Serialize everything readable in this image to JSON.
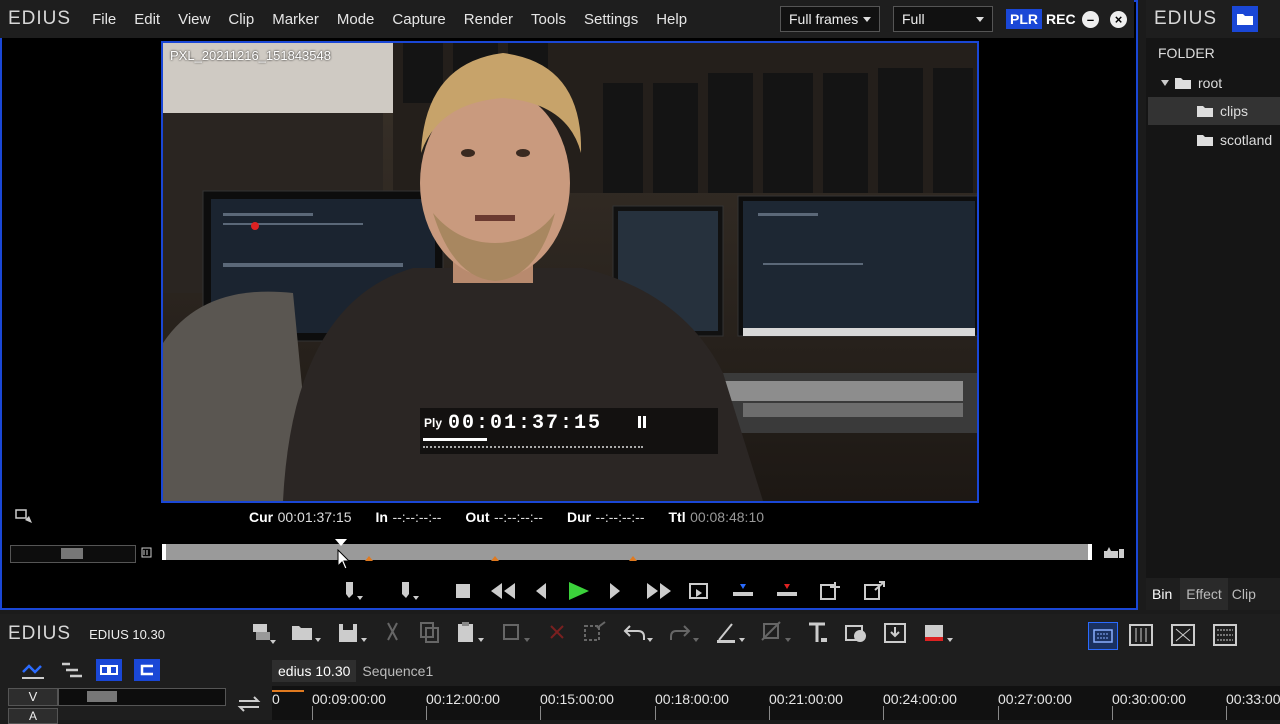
{
  "app": {
    "logo": "EDIUS"
  },
  "menu": [
    "File",
    "Edit",
    "View",
    "Clip",
    "Marker",
    "Mode",
    "Capture",
    "Render",
    "Tools",
    "Settings",
    "Help"
  ],
  "player": {
    "frames_mode": "Full frames",
    "quality": "Full",
    "plr": "PLR",
    "rec": "REC",
    "clip_name": "PXL_20211216_151843548",
    "osd_mode": "Ply",
    "osd_timecode": "00:01:37:15",
    "cur_label": "Cur",
    "cur_value": "00:01:37:15",
    "in_label": "In",
    "in_value": "--:--:--:--",
    "out_label": "Out",
    "out_value": "--:--:--:--",
    "dur_label": "Dur",
    "dur_value": "--:--:--:--",
    "ttl_label": "Ttl",
    "ttl_value": "00:08:48:10",
    "playhead_fraction": 0.19
  },
  "bin": {
    "logo": "EDIUS",
    "folder_header": "FOLDER",
    "root": "root",
    "folders": [
      "clips",
      "scotland"
    ],
    "tabs": [
      "Bin",
      "Effect",
      "Clip"
    ]
  },
  "timeline": {
    "logo": "EDIUS",
    "project": "EDIUS 10.30",
    "tabs": [
      "edius 10.30",
      "Sequence1"
    ],
    "track_v": "V",
    "track_a": "A",
    "ruler": [
      "0",
      "00:09:00:00",
      "00:12:00:00",
      "00:15:00:00",
      "00:18:00:00",
      "00:21:00:00",
      "00:24:00:00",
      "00:27:00:00",
      "00:30:00:00",
      "00:33:00"
    ]
  },
  "colors": {
    "accent": "#1a47d6",
    "play_green": "#3bd13b",
    "marker_orange": "#e07a20"
  }
}
